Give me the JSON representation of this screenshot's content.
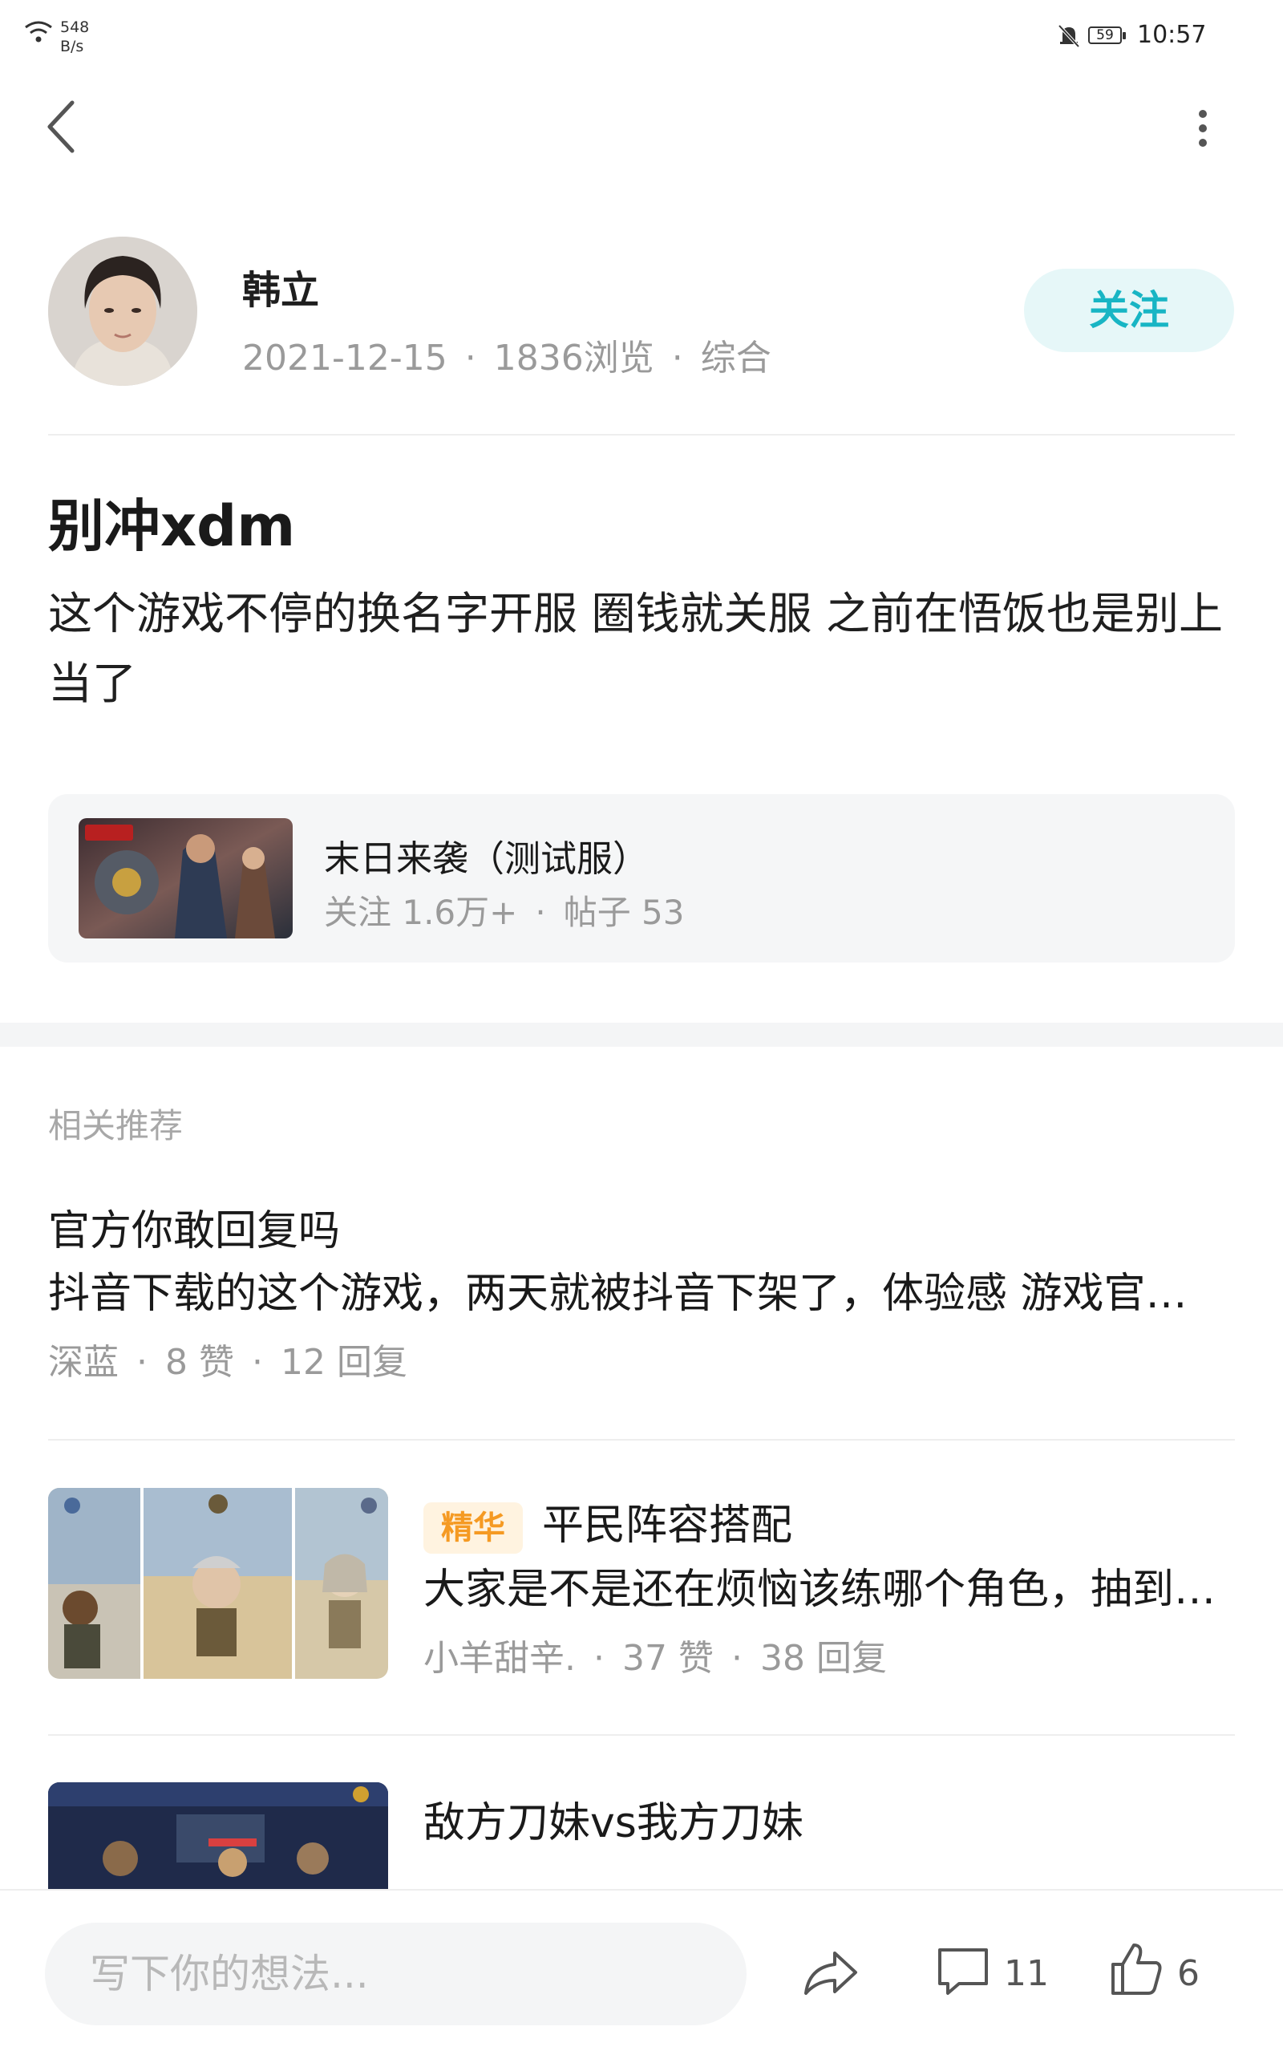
{
  "status_bar": {
    "net_speed_value": "548",
    "net_speed_unit": "B/s",
    "battery": "59",
    "time": "10:57"
  },
  "author": {
    "name": "韩立",
    "date": "2021-12-15",
    "views": "1836浏览",
    "category": "综合",
    "follow_label": "关注"
  },
  "post": {
    "title": "别冲xdm",
    "body": "这个游戏不停的换名字开服 圈钱就关服 之前在悟饭也是别上当了"
  },
  "game_card": {
    "name": "末日来袭（测试服）",
    "followers": "关注 1.6万+",
    "posts": "帖子 53"
  },
  "related": {
    "label": "相关推荐",
    "items": [
      {
        "title": "官方你敢回复吗",
        "excerpt": "抖音下载的这个游戏，两天就被抖音下架了，体验感 游戏官方…",
        "author": "深蓝",
        "likes": "8 赞",
        "replies": "12 回复"
      },
      {
        "badge": "精华",
        "title": "平民阵容搭配",
        "excerpt": "大家是不是还在烦恼该练哪个角色，抽到了…",
        "author": "小羊甜辛.",
        "likes": "37 赞",
        "replies": "38 回复"
      },
      {
        "title": "敌方刀妹vs我方刀妹"
      }
    ]
  },
  "bottom_bar": {
    "comment_placeholder": "写下你的想法...",
    "comments_count": "11",
    "likes_count": "6"
  },
  "colors": {
    "accent": "#18b5c4",
    "follow_bg": "#e6f7f8",
    "badge_text": "#f59a23",
    "badge_bg": "#fff3e0",
    "meta_gray": "#9a9a9a"
  }
}
